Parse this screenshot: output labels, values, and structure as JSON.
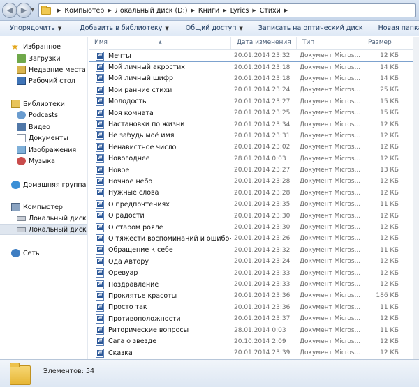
{
  "address": {
    "crumbs": [
      "Компьютер",
      "Локальный диск (D:)",
      "Книги",
      "Lyrics",
      "Стихи"
    ]
  },
  "toolbar": {
    "organize": "Упорядочить",
    "add_to_library": "Добавить в библиотеку",
    "share": "Общий доступ",
    "burn": "Записать на оптический диск",
    "new_folder": "Новая папка"
  },
  "nav": {
    "favorites": "Избранное",
    "downloads": "Загрузки",
    "recent": "Недавние места",
    "desktop": "Рабочий стол",
    "libraries": "Библиотеки",
    "podcasts": "Podcasts",
    "video": "Видео",
    "documents": "Документы",
    "images": "Изображения",
    "music": "Музыка",
    "homegroup": "Домашняя группа",
    "computer": "Компьютер",
    "disk_c": "Локальный диск (C",
    "disk_d": "Локальный диск (D",
    "network": "Сеть"
  },
  "columns": {
    "name": "Имя",
    "date": "Дата изменения",
    "type": "Тип",
    "size": "Размер"
  },
  "files": [
    {
      "name": "Мечты",
      "date": "20.01.2014 23:32",
      "type": "Документ Micros...",
      "size": "12 КБ"
    },
    {
      "name": "Мой личный акростих",
      "date": "20.01.2014 23:18",
      "type": "Документ Micros...",
      "size": "14 КБ"
    },
    {
      "name": "Мой личный шифр",
      "date": "20.01.2014 23:18",
      "type": "Документ Micros...",
      "size": "14 КБ"
    },
    {
      "name": "Мои ранние стихи",
      "date": "20.01.2014 23:24",
      "type": "Документ Micros...",
      "size": "25 КБ"
    },
    {
      "name": "Молодость",
      "date": "20.01.2014 23:27",
      "type": "Документ Micros...",
      "size": "15 КБ"
    },
    {
      "name": "Моя комната",
      "date": "20.01.2014 23:25",
      "type": "Документ Micros...",
      "size": "15 КБ"
    },
    {
      "name": "Настановки по жизни",
      "date": "20.01.2014 23:34",
      "type": "Документ Micros...",
      "size": "12 КБ"
    },
    {
      "name": "Не забудь моё имя",
      "date": "20.01.2014 23:31",
      "type": "Документ Micros...",
      "size": "12 КБ"
    },
    {
      "name": "Ненавистное число",
      "date": "20.01.2014 23:02",
      "type": "Документ Micros...",
      "size": "12 КБ"
    },
    {
      "name": "Новогоднее",
      "date": "28.01.2014 0:03",
      "type": "Документ Micros...",
      "size": "12 КБ"
    },
    {
      "name": "Новое",
      "date": "20.01.2014 23:27",
      "type": "Документ Micros...",
      "size": "13 КБ"
    },
    {
      "name": "Ночное небо",
      "date": "20.01.2014 23:28",
      "type": "Документ Micros...",
      "size": "12 КБ"
    },
    {
      "name": "Нужные слова",
      "date": "20.01.2014 23:28",
      "type": "Документ Micros...",
      "size": "12 КБ"
    },
    {
      "name": "О предпочтениях",
      "date": "20.01.2014 23:35",
      "type": "Документ Micros...",
      "size": "11 КБ"
    },
    {
      "name": "О радости",
      "date": "20.01.2014 23:30",
      "type": "Документ Micros...",
      "size": "12 КБ"
    },
    {
      "name": "О старом рояле",
      "date": "20.01.2014 23:30",
      "type": "Документ Micros...",
      "size": "12 КБ"
    },
    {
      "name": "О тяжести воспоминаний и ошибок",
      "date": "20.01.2014 23:26",
      "type": "Документ Micros...",
      "size": "12 КБ"
    },
    {
      "name": "Обращение к себе",
      "date": "20.01.2014 23:32",
      "type": "Документ Micros...",
      "size": "11 КБ"
    },
    {
      "name": "Ода Автору",
      "date": "20.01.2014 23:24",
      "type": "Документ Micros...",
      "size": "12 КБ"
    },
    {
      "name": "Оревуар",
      "date": "20.01.2014 23:33",
      "type": "Документ Micros...",
      "size": "12 КБ"
    },
    {
      "name": "Поздравление",
      "date": "20.01.2014 23:33",
      "type": "Документ Micros...",
      "size": "12 КБ"
    },
    {
      "name": "Проклятье красоты",
      "date": "20.01.2014 23:36",
      "type": "Документ Micros...",
      "size": "186 КБ"
    },
    {
      "name": "Просто так",
      "date": "20.01.2014 23:36",
      "type": "Документ Micros...",
      "size": "11 КБ"
    },
    {
      "name": "Противоположности",
      "date": "20.01.2014 23:37",
      "type": "Документ Micros...",
      "size": "12 КБ"
    },
    {
      "name": "Риторические вопросы",
      "date": "28.01.2014 0:03",
      "type": "Документ Micros...",
      "size": "11 КБ"
    },
    {
      "name": "Сага о звезде",
      "date": "20.10.2014 2:09",
      "type": "Документ Micros...",
      "size": "12 КБ"
    },
    {
      "name": "Сказка",
      "date": "20.01.2014 23:39",
      "type": "Документ Micros...",
      "size": "12 КБ"
    }
  ],
  "status": {
    "count": "Элементов: 54"
  }
}
